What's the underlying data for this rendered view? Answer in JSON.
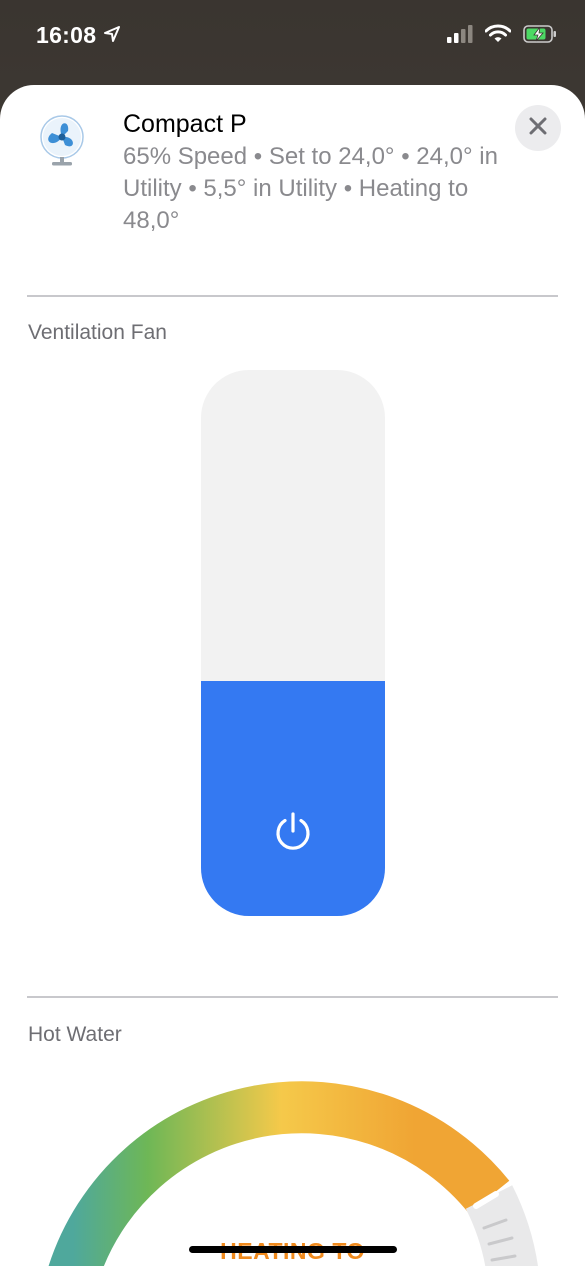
{
  "status_bar": {
    "time": "16:08"
  },
  "header": {
    "title": "Compact P",
    "subtitle": "65% Speed • Set to 24,0° • 24,0° in Utility • 5,5° in Utility • Heating to 48,0°"
  },
  "sections": {
    "ventilation": {
      "label": "Ventilation Fan",
      "speed_percent": 65,
      "fill_color": "#3479f2"
    },
    "hot_water": {
      "label": "Hot Water",
      "caption": "HEATING TO"
    }
  },
  "colors": {
    "accent_blue": "#3479f2",
    "caption_orange": "#f08a1d"
  }
}
